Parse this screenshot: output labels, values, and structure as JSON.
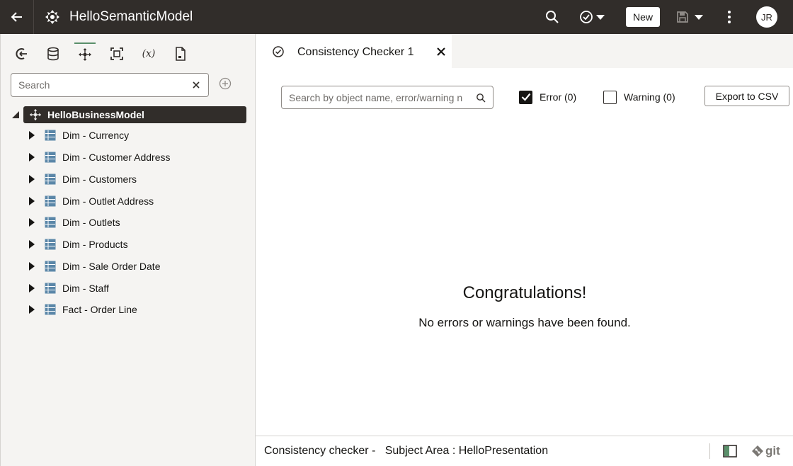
{
  "header": {
    "title": "HelloSemanticModel",
    "new_label": "New",
    "avatar_initials": "JR"
  },
  "left": {
    "search_placeholder": "Search",
    "tree": {
      "root_label": "HelloBusinessModel",
      "items": [
        {
          "label": "Dim - Currency"
        },
        {
          "label": "Dim - Customer Address"
        },
        {
          "label": "Dim - Customers"
        },
        {
          "label": "Dim - Outlet Address"
        },
        {
          "label": "Dim - Outlets"
        },
        {
          "label": "Dim - Products"
        },
        {
          "label": "Dim - Sale Order Date"
        },
        {
          "label": "Dim - Staff"
        },
        {
          "label": "Fact - Order Line"
        }
      ]
    }
  },
  "tab": {
    "label": "Consistency Checker 1"
  },
  "checker": {
    "search_placeholder": "Search by object name, error/warning n",
    "error_label": "Error (0)",
    "error_checked": true,
    "warning_label": "Warning (0)",
    "warning_checked": false,
    "export_label": "Export to CSV",
    "congrats": "Congratulations!",
    "message": "No errors or warnings have been found."
  },
  "status": {
    "text": "Consistency checker -   Subject Area : HelloPresentation",
    "git_label": "git"
  },
  "colors": {
    "header_bg": "#312d2a",
    "panel_bg": "#f5f4f2",
    "accent": "#5a8f6a",
    "table_icon": "#5b87a8"
  }
}
